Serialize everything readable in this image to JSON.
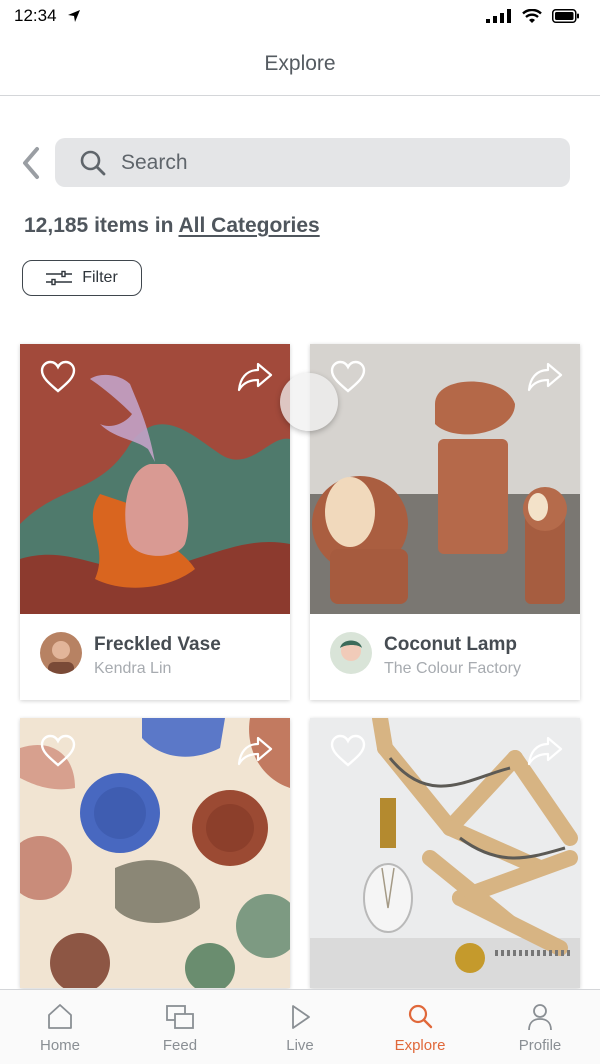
{
  "status_bar": {
    "time": "12:34"
  },
  "nav": {
    "title": "Explore"
  },
  "search": {
    "placeholder": "Search"
  },
  "results": {
    "count_text": "12,185 items in ",
    "category_link": "All Categories"
  },
  "filter": {
    "label": "Filter"
  },
  "cards": [
    {
      "title": "Freckled Vase",
      "author": "Kendra Lin"
    },
    {
      "title": "Coconut Lamp",
      "author": "The Colour Factory"
    },
    {
      "title": "",
      "author": ""
    },
    {
      "title": "",
      "author": ""
    }
  ],
  "tabs": [
    {
      "label": "Home",
      "icon": "home-icon"
    },
    {
      "label": "Feed",
      "icon": "feed-icon"
    },
    {
      "label": "Live",
      "icon": "play-icon"
    },
    {
      "label": "Explore",
      "icon": "search-icon",
      "active": true
    },
    {
      "label": "Profile",
      "icon": "profile-icon"
    }
  ],
  "colors": {
    "accent": "#e0683a",
    "text": "#4a5158",
    "muted": "#a7abb0",
    "search_bg": "#e4e5e7"
  }
}
